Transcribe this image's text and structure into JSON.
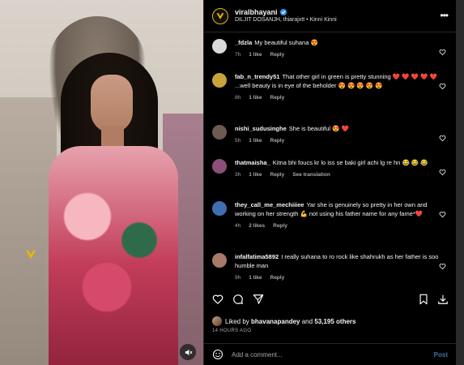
{
  "post": {
    "username": "viralbhayani",
    "subtitle": "DILJIT DOSANJH, thiarajxtt • Kinni Kinni"
  },
  "comments": [
    {
      "user": "_fdzla",
      "text": "My beautiful suhana 😍",
      "time": "7h",
      "likes": "1 like",
      "reply": "Reply",
      "avatar_color": "#d9d9d9"
    },
    {
      "user": "fab_n_trendy51",
      "text": "That other girl in green is pretty stunning ❤️ ❤️ ❤️ ❤️ ❤️ ...well beauty is in eye of the beholder 😍 😍 😍 😍 😍",
      "time": "8h",
      "likes": "1 like",
      "reply": "Reply",
      "avatar_color": "#c9a23b"
    },
    {
      "user": "nishi_sudusinghe",
      "text": "She is beautiful 😍 ❤️",
      "time": "5h",
      "likes": "1 like",
      "reply": "Reply",
      "avatar_color": "#6d5a52"
    },
    {
      "user": "thatmaisha_",
      "text": "Kitna bhi foucs kr lo iss se baki girl achi lg re hn 😂 😂 😂",
      "time": "3h",
      "likes": "1 like",
      "reply": "Reply",
      "translation": "See translation",
      "avatar_color": "#8b4f7a"
    },
    {
      "user": "they_call_me_mechiiiee",
      "text": "Yar she is genuinely so pretty in her own and working on her strength 💪 not using his father name for any fame*❤️",
      "time": "4h",
      "likes": "2 likes",
      "reply": "Reply",
      "avatar_color": "#3e6fb0"
    },
    {
      "user": "infalfatima5892",
      "text": "I really suhana to ro rock like shahrukh as her father is soo humble man",
      "time": "9h",
      "likes": "1 like",
      "reply": "Reply",
      "avatar_color": "#a87a68"
    }
  ],
  "likes": {
    "prefix": "Liked by",
    "user": "bhavanapandey",
    "and": "and",
    "count": "53,195 others"
  },
  "timestamp": "14 HOURS AGO",
  "add_comment": {
    "placeholder": "Add a comment...",
    "post_label": "Post"
  }
}
